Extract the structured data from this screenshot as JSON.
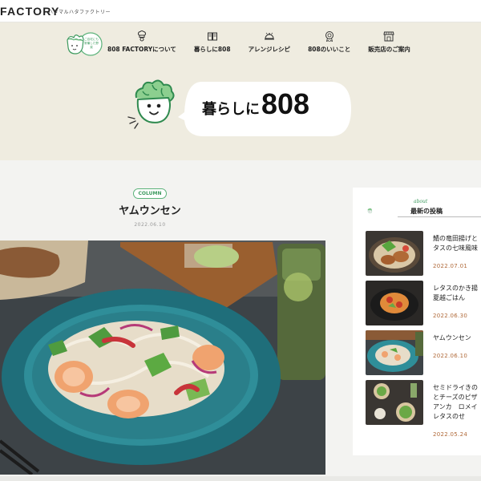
{
  "site": {
    "logo_text": "FACTORY",
    "logo_sub": "ハタマルハタファクトリー",
    "badge_text": "ご自宅にも常備した野菜"
  },
  "nav": {
    "items": [
      {
        "label": "808 FACTORYについて",
        "icon": "chef-icon"
      },
      {
        "label": "暮らしに808",
        "icon": "book-icon"
      },
      {
        "label": "アレンジレシピ",
        "icon": "cloche-icon"
      },
      {
        "label": "808のいいこと",
        "icon": "badge-icon"
      },
      {
        "label": "販売店のご案内",
        "icon": "store-icon"
      }
    ]
  },
  "hero": {
    "title_jp": "暮らしに",
    "title_num": "808"
  },
  "article": {
    "tag": "COLUMN",
    "title": "ヤムウンセン",
    "date": "2022.06.10"
  },
  "sidebar": {
    "about": "about",
    "title": "最新の投稿",
    "posts": [
      {
        "title_lines": [
          "鯖の竜田揚げと",
          "タスの七味風味"
        ],
        "date": "2022.07.01"
      },
      {
        "title_lines": [
          "レタスのかき揚",
          "夏越ごはん"
        ],
        "date": "2022.06.30"
      },
      {
        "title_lines": [
          "ヤムウンセン"
        ],
        "date": "2022.06.10"
      },
      {
        "title_lines": [
          "セミドライきの",
          "とチーズのピザ",
          "アンカ　ロメイ",
          "レタスのせ"
        ],
        "date": "2022.05.24"
      }
    ]
  },
  "colors": {
    "accent_green": "#3d9a5e",
    "hero_bg": "#efece0",
    "date_orange": "#b06a3a"
  }
}
